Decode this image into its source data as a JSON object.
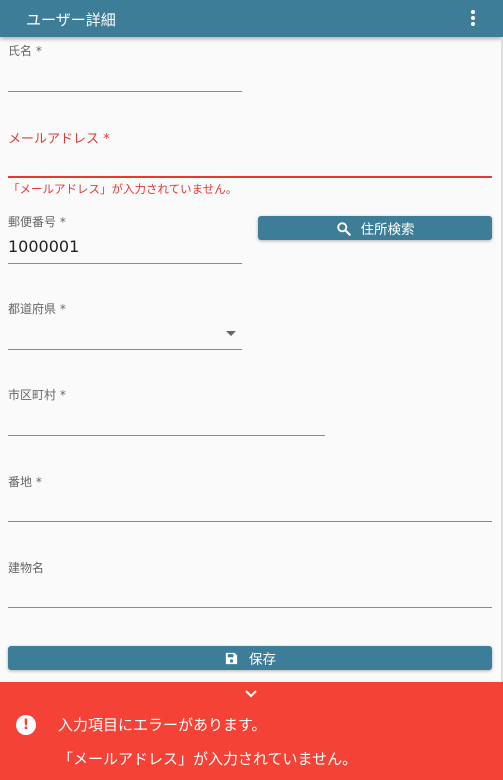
{
  "appbar": {
    "title": "ユーザー詳細",
    "menu_icon": "more-vert-icon"
  },
  "form": {
    "name": {
      "label": "氏名 *",
      "value": ""
    },
    "email": {
      "label": "メールアドレス *",
      "value": "",
      "error": "「メールアドレス」が入力されていません。"
    },
    "postal": {
      "label": "郵便番号 *",
      "value": "1000001"
    },
    "address_search": {
      "label": "住所検索",
      "icon": "search-icon"
    },
    "prefecture": {
      "label": "都道府県 *",
      "value": ""
    },
    "city": {
      "label": "市区町村 *",
      "value": ""
    },
    "street": {
      "label": "番地 *",
      "value": ""
    },
    "building": {
      "label": "建物名",
      "value": ""
    },
    "save": {
      "label": "保存",
      "icon": "save-icon"
    }
  },
  "snackbar": {
    "title": "入力項目にエラーがあります。",
    "message": "「メールアドレス」が入力されていません。",
    "icon": "error-icon",
    "collapse_icon": "chevron-down-icon"
  },
  "colors": {
    "primary": "#3e7d98",
    "error": "#e53935",
    "snackbar": "#f44336"
  }
}
